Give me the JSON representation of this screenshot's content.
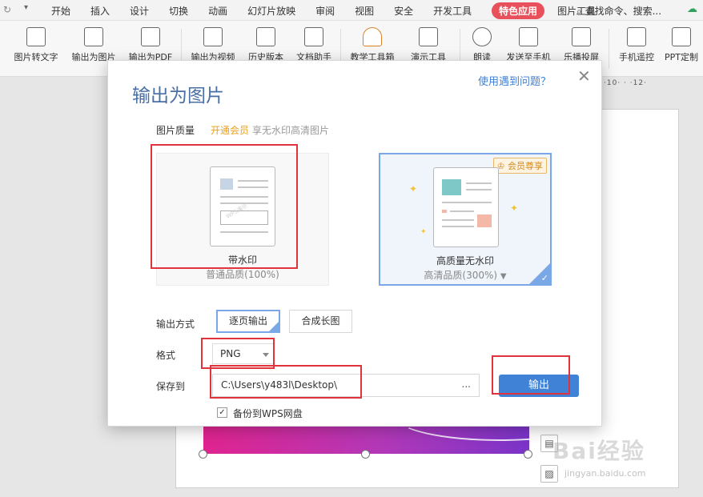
{
  "menubar": {
    "items": [
      "开始",
      "插入",
      "设计",
      "切换",
      "动画",
      "幻灯片放映",
      "审阅",
      "视图",
      "安全",
      "开发工具",
      "特色应用",
      "图片工具"
    ],
    "active_index": 10,
    "search_placeholder": "查找命令、搜索...",
    "accent": "#e8505b"
  },
  "ribbon": {
    "buttons": [
      {
        "label": "图片转文字",
        "icon": "image-to-text-icon"
      },
      {
        "label": "输出为图片",
        "icon": "export-image-icon"
      },
      {
        "label": "输出为PDF",
        "icon": "export-pdf-icon"
      },
      {
        "label": "输出为视频",
        "icon": "export-video-icon"
      },
      {
        "label": "历史版本",
        "icon": "history-icon"
      },
      {
        "label": "文档助手",
        "icon": "doc-assistant-icon"
      },
      {
        "label": "教学工具箱",
        "icon": "teaching-toolbox-icon"
      },
      {
        "label": "演示工具",
        "icon": "presentation-tools-icon"
      },
      {
        "label": "朗读",
        "icon": "microphone-icon"
      },
      {
        "label": "发送至手机",
        "icon": "send-to-phone-icon"
      },
      {
        "label": "乐播投屏",
        "icon": "cast-screen-icon"
      },
      {
        "label": "手机遥控",
        "icon": "phone-remote-icon"
      },
      {
        "label": "PPT定制",
        "icon": "ppt-custom-icon"
      }
    ]
  },
  "ruler": {
    "text": "·10· · ·12·"
  },
  "dialog": {
    "title": "输出为图片",
    "help_link": "使用遇到问题？",
    "close_icon": "close-icon",
    "quality": {
      "label": "图片质量",
      "vip_link": "开通会员",
      "vip_note": "享无水印高清图片",
      "options": [
        {
          "name": "带水印",
          "sub": "普通品质(100%)",
          "watermark_text": "WPS演示"
        },
        {
          "name": "高质量无水印",
          "sub": "高清品质(300%)",
          "badge": "会员尊享"
        }
      ]
    },
    "output_mode": {
      "label": "输出方式",
      "options": [
        "逐页输出",
        "合成长图"
      ],
      "selected": 0
    },
    "format": {
      "label": "格式",
      "value": "PNG"
    },
    "save_to": {
      "label": "保存到",
      "path": "C:\\Users\\y483l\\Desktop\\",
      "browse": "..."
    },
    "export_button": "输出",
    "backup": {
      "label": "备份到WPS网盘",
      "checked": true
    },
    "colors": {
      "title": "#4a6fa5",
      "link": "#3d7fd6",
      "vip": "#e9a11a",
      "primary": "#3f82d6",
      "selected_border": "#7aa7e6",
      "annotation": "#e0333c"
    }
  },
  "watermark": {
    "brand": "Bai经验",
    "url": "jingyan.baidu.com"
  }
}
